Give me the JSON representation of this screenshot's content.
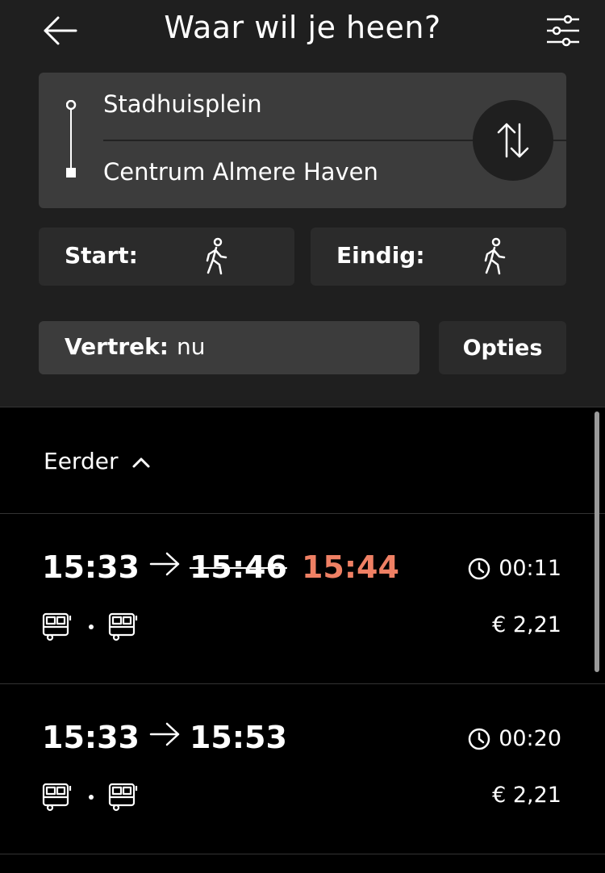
{
  "header": {
    "title": "Waar wil je heen?",
    "back_icon": "arrow-left-icon",
    "filter_icon": "sliders-icon"
  },
  "route": {
    "from": "Stadhuisplein",
    "to": "Centrum Almere Haven",
    "swap_icon": "swap-vertical-icon"
  },
  "start": {
    "label": "Start:",
    "icon": "walking-person-icon"
  },
  "end": {
    "label": "Eindig:",
    "icon": "walking-person-icon"
  },
  "departure": {
    "label": "Vertrek:",
    "value": "nu"
  },
  "options_label": "Opties",
  "earlier_label": "Eerder",
  "trips": [
    {
      "depart": "15:33",
      "arrive_planned": "15:46",
      "arrive_actual": "15:44",
      "duration": "00:11",
      "price": "€ 2,21",
      "modes": [
        "bus",
        "bus"
      ]
    },
    {
      "depart": "15:33",
      "arrive": "15:53",
      "duration": "00:20",
      "price": "€ 2,21",
      "modes": [
        "bus",
        "bus"
      ]
    }
  ],
  "colors": {
    "background": "#000000",
    "header_bg": "#1f1f1f",
    "card_bg": "#3c3c3c",
    "pill_bg": "#2b2b2b",
    "delay": "#ef8064"
  }
}
